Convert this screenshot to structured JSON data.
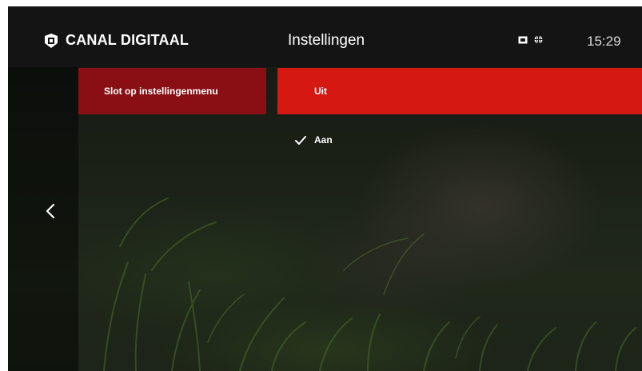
{
  "header": {
    "brand": "CANAL DIGITAAL",
    "title": "Instellingen",
    "clock": "15:29",
    "status_icons": [
      "recording-icon",
      "globe-icon"
    ]
  },
  "menu": {
    "selected_item": "Slot op instellingenmenu"
  },
  "options": {
    "focused": "Uit",
    "checked": "Aan"
  },
  "colors": {
    "accent": "#d51812",
    "menu_selected": "#8a0f14",
    "topbar": "#141414"
  },
  "icons": {
    "back": "chevron-left-icon",
    "check": "checkmark-icon",
    "logo": "canal-digitaal-logo-icon"
  }
}
